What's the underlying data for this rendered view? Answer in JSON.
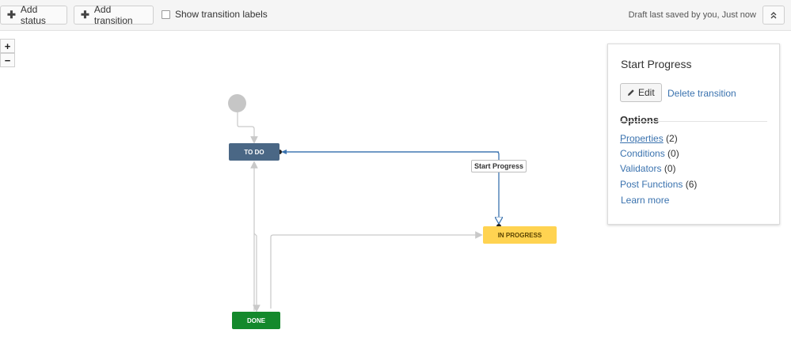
{
  "toolbar": {
    "add_status_label": "Add status",
    "add_transition_label": "Add transition",
    "show_labels_label": "Show transition labels",
    "show_labels_checked": false,
    "draft_status": "Draft last saved by you, Just now"
  },
  "zoom": {
    "in_label": "+",
    "out_label": "−"
  },
  "workflow": {
    "statuses": {
      "todo": "TO DO",
      "in_progress": "IN PROGRESS",
      "done": "DONE"
    },
    "selected_transition_label": "Start Progress",
    "colors": {
      "todo": "#4a6785",
      "in_progress": "#ffd351",
      "done": "#14892c",
      "selected_line": "#3b73af",
      "line": "#c9c9c9"
    }
  },
  "panel": {
    "title": "Start Progress",
    "edit_label": "Edit",
    "delete_label": "Delete transition",
    "options_heading": "Options",
    "options": [
      {
        "label": "Properties",
        "count": "(2)"
      },
      {
        "label": "Conditions",
        "count": "(0)"
      },
      {
        "label": "Validators",
        "count": "(0)"
      },
      {
        "label": "Post Functions",
        "count": "(6)"
      }
    ],
    "learn_more": "Learn more"
  }
}
